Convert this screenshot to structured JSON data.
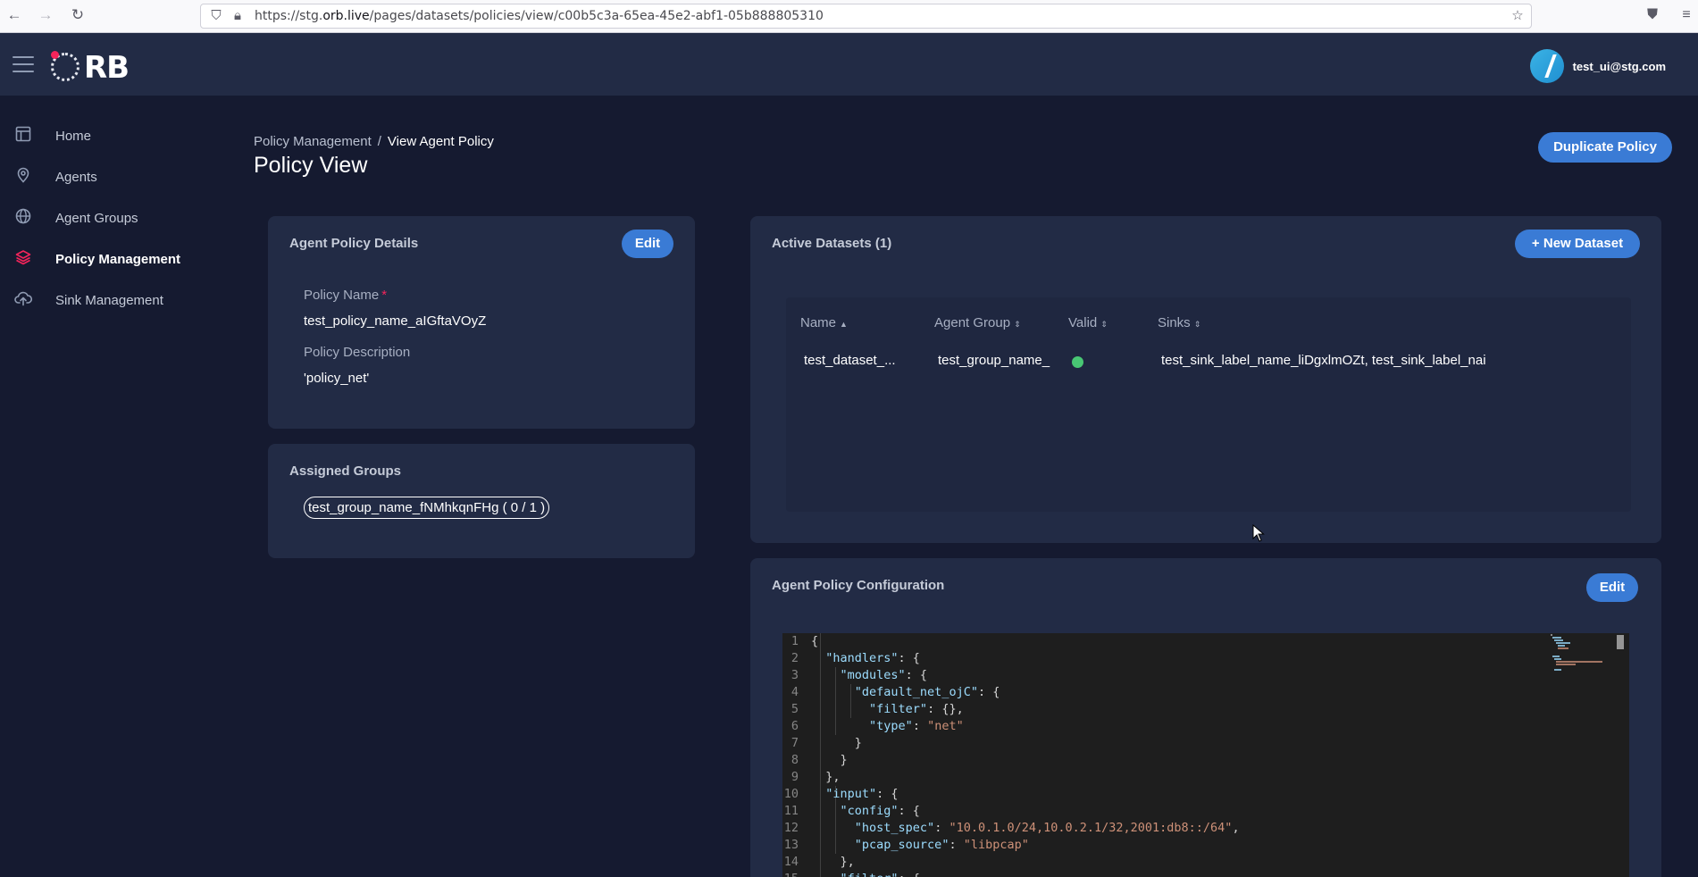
{
  "browser": {
    "url_prefix": "https://stg.",
    "url_domain": "orb.live",
    "url_path": "/pages/datasets/policies/view/c00b5c3a-65ea-45e2-abf1-05b888805310"
  },
  "header": {
    "logo_text": "RB",
    "user_email": "test_ui@stg.com"
  },
  "sidebar": {
    "items": [
      {
        "label": "Home",
        "icon": "layout-icon"
      },
      {
        "label": "Agents",
        "icon": "pin-icon"
      },
      {
        "label": "Agent Groups",
        "icon": "globe-icon"
      },
      {
        "label": "Policy Management",
        "icon": "layers-icon",
        "active": true
      },
      {
        "label": "Sink Management",
        "icon": "cloud-upload-icon"
      }
    ]
  },
  "breadcrumb": {
    "parent": "Policy Management",
    "separator": "/",
    "current": "View Agent Policy"
  },
  "page": {
    "title": "Policy View",
    "duplicate_label": "Duplicate Policy"
  },
  "details_card": {
    "title": "Agent Policy Details",
    "edit_label": "Edit",
    "name_label": "Policy Name",
    "required_mark": "*",
    "name_value": "test_policy_name_aIGftaVOyZ",
    "description_label": "Policy Description",
    "description_value": "'policy_net'"
  },
  "groups_card": {
    "title": "Assigned Groups",
    "chip": "test_group_name_fNMhkqnFHg ( 0 / 1 )"
  },
  "datasets_card": {
    "title": "Active Datasets (1)",
    "new_label": "New Dataset",
    "columns": [
      "Name",
      "Agent Group",
      "Valid",
      "Sinks"
    ],
    "rows": [
      {
        "name": "test_dataset_...",
        "agent_group": "test_group_name_",
        "valid": true,
        "sinks": "test_sink_label_name_liDgxlmOZt,  test_sink_label_nai"
      }
    ]
  },
  "config_card": {
    "title": "Agent Policy Configuration",
    "edit_label": "Edit",
    "code_lines": [
      "{",
      "  \"handlers\": {",
      "    \"modules\": {",
      "      \"default_net_ojC\": {",
      "        \"filter\": {},",
      "        \"type\": \"net\"",
      "      }",
      "    }",
      "  },",
      "  \"input\": {",
      "    \"config\": {",
      "      \"host_spec\": \"10.0.1.0/24,10.0.2.1/32,2001:db8::/64\",",
      "      \"pcap_source\": \"libpcap\"",
      "    },",
      "    \"filter\": {"
    ]
  },
  "colors": {
    "accent": "#3a7bd5",
    "brand": "#f5245b",
    "valid": "#48c774",
    "card": "#222b45",
    "background": "#151a30"
  }
}
